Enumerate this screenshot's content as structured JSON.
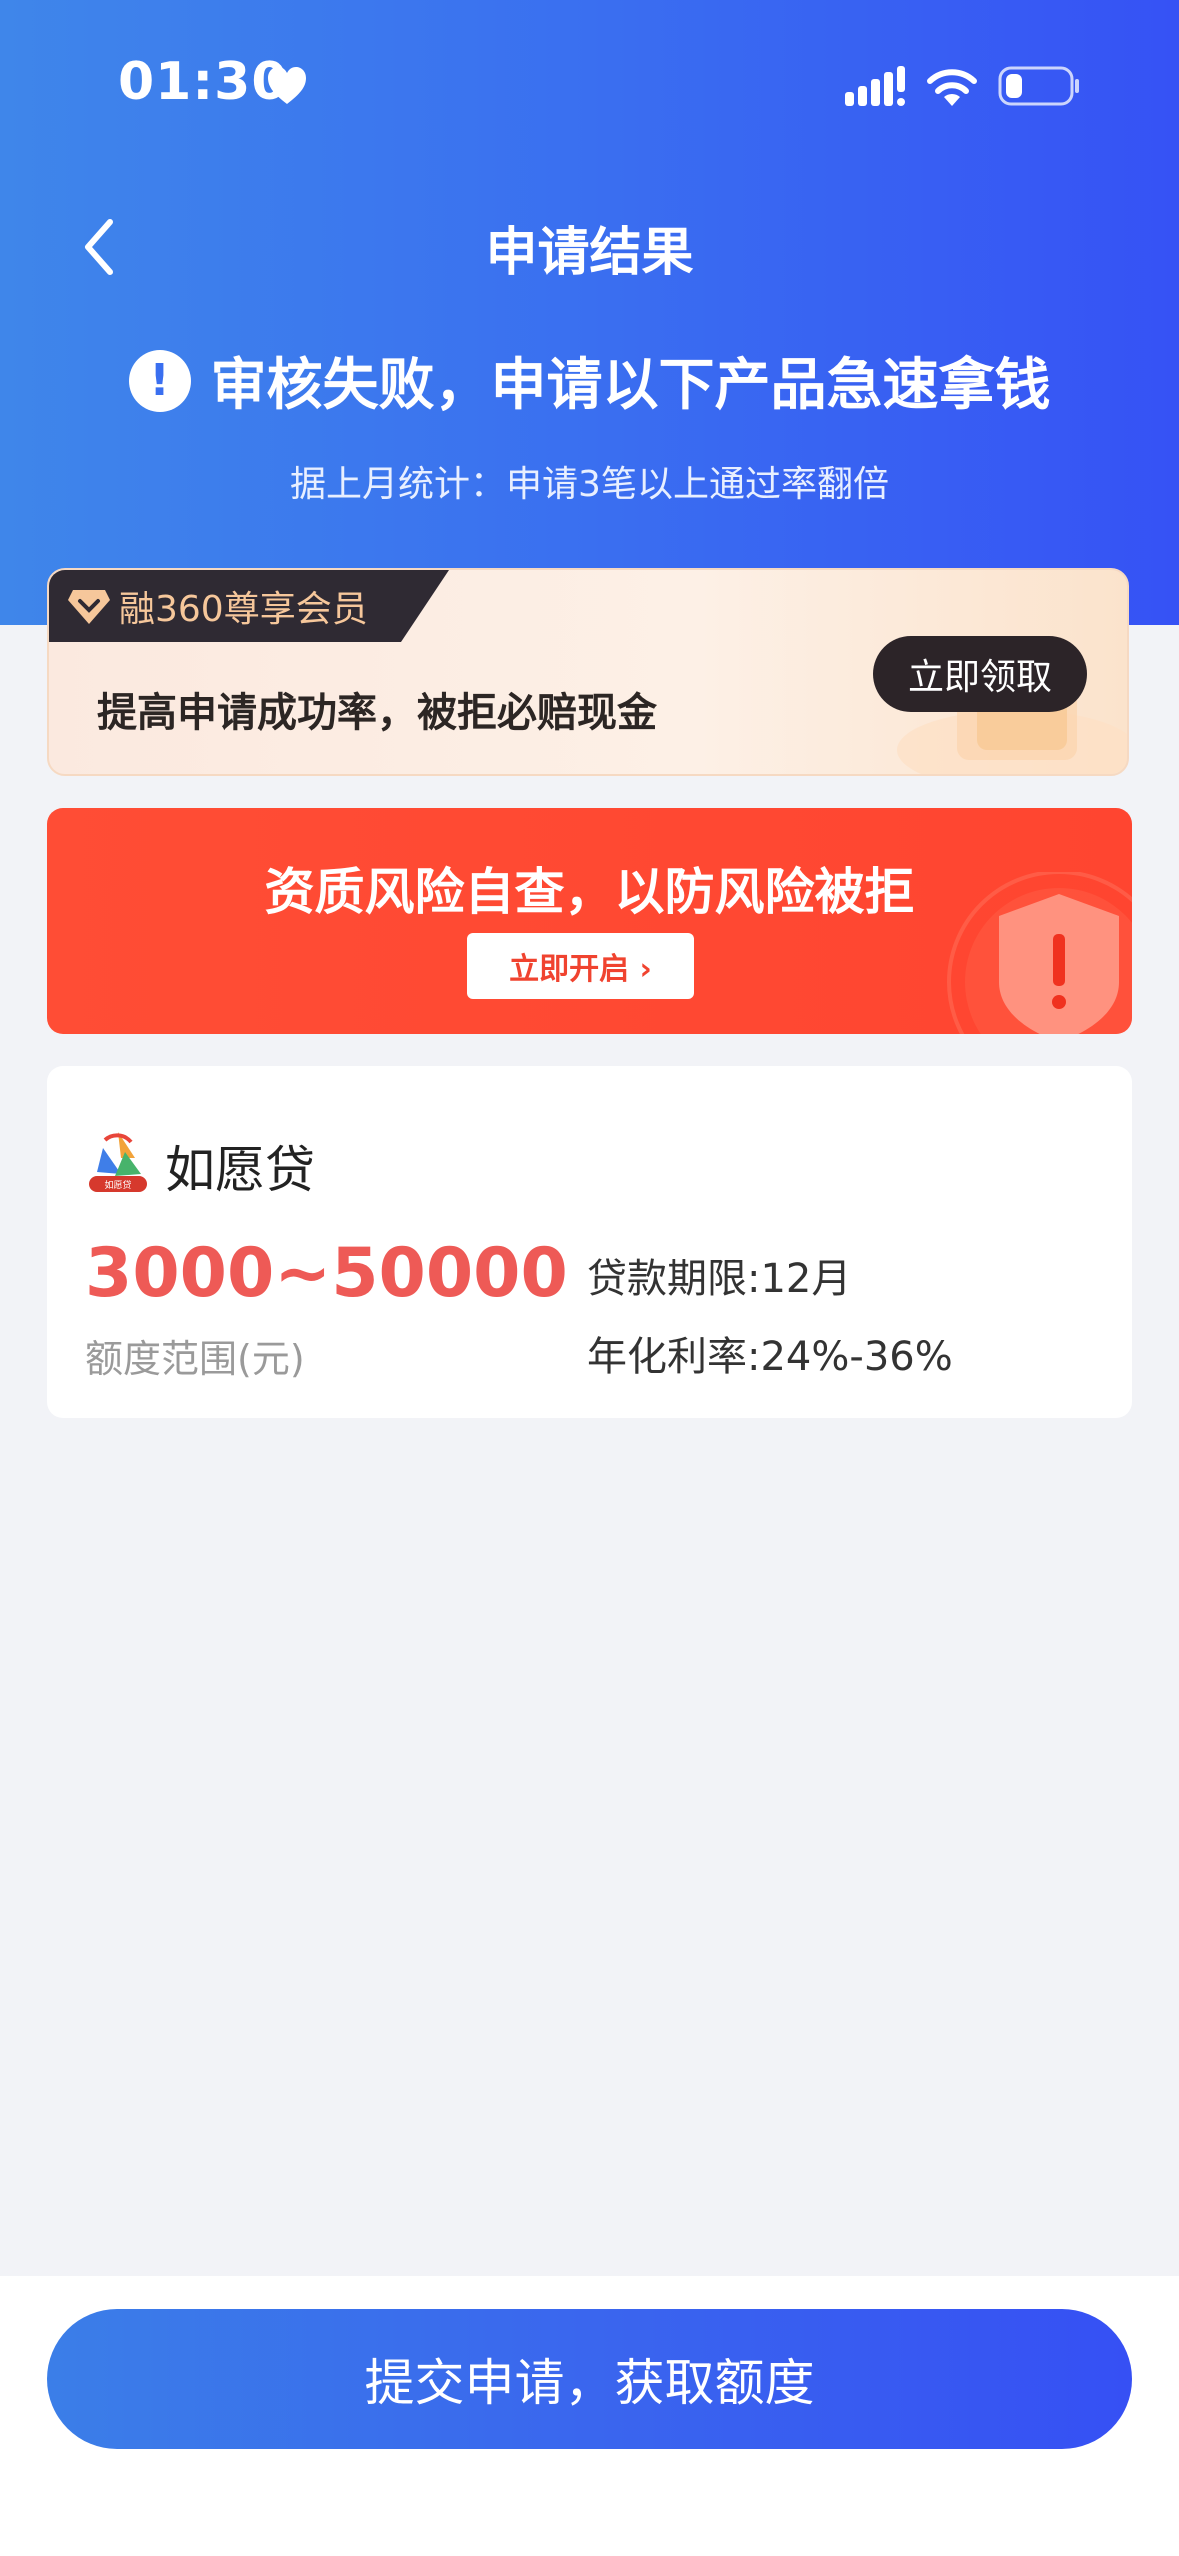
{
  "status_bar": {
    "time": "01:30"
  },
  "header": {
    "title": "申请结果",
    "alert_icon_symbol": "!",
    "alert_text": "审核失败，申请以下产品急速拿钱",
    "stat_text": "据上月统计：申请3笔以上通过率翻倍"
  },
  "member_card": {
    "tag": "融360尊享会员",
    "text": "提高申请成功率，被拒必赔现金",
    "button": "立即领取"
  },
  "risk_card": {
    "title": "资质风险自查，以防风险被拒",
    "button": "立即开启 ›"
  },
  "product": {
    "name": "如愿贷",
    "logo_caption": "如愿贷",
    "amount_range": "3000~50000",
    "amount_label": "额度范围(元)",
    "loan_term": "贷款期限:12月",
    "annual_rate": "年化利率:24%-36%"
  },
  "footer": {
    "submit_button": "提交申请，获取额度"
  },
  "colors": {
    "header_gradient_start": "#3f86ea",
    "header_gradient_end": "#3652f5",
    "amount_red": "#ee5a56",
    "risk_red": "#ff4d35"
  },
  "icons": [
    "heart-icon",
    "signal-icon",
    "wifi-icon",
    "battery-icon",
    "back-icon",
    "alert-icon",
    "diamond-icon",
    "shield-icon",
    "product-logo-icon"
  ]
}
